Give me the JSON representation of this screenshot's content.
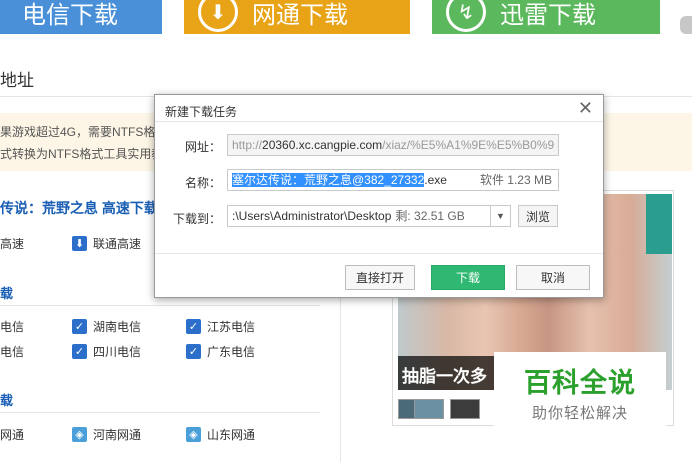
{
  "top_buttons": {
    "telecom": "电信下载",
    "netcom": "网通下载",
    "thunder": "迅雷下载"
  },
  "page": {
    "address_title": "地址",
    "notice_line1": "果游戏超过4G，需要NTFS格式",
    "notice_line2": "式转换为NTFS格式工具实用教",
    "game_title": "传说：荒野之息 高速下载",
    "first_row": [
      {
        "label": "高速"
      },
      {
        "label": "联通高速"
      }
    ],
    "telecom_section": "载",
    "telecom_links": [
      [
        "电信",
        "湖南电信",
        "江苏电信"
      ],
      [
        "电信",
        "四川电信",
        "广东电信"
      ]
    ],
    "netcom_section": "载",
    "netcom_links": [
      "网通",
      "河南网通",
      "山东网通"
    ],
    "photo_caption": "抽脂一次多",
    "watermark_line1": "百科全说",
    "watermark_line2": "助你轻松解决"
  },
  "dialog": {
    "title": "新建下载任务",
    "url_label": "网址：",
    "url_prefix": "http://",
    "url_host": "20360.xc.cangpie.com",
    "url_rest": "/xiaz/%E5%A1%9E%E5%B0%9",
    "name_label": "名称：",
    "name_selected": "塞尔达传说：荒野之息@382_27332",
    "name_ext": ".exe",
    "size_text": "软件 1.23 MB",
    "save_label": "下载到：",
    "save_path": ":\\Users\\Administrator\\Desktop",
    "free_space": "剩: 32.51 GB",
    "browse_label": "浏览",
    "open_label": "直接打开",
    "download_label": "下载",
    "cancel_label": "取消"
  },
  "colors": {
    "telecom_button": "#4a90d9",
    "netcom_button": "#e8a317",
    "thunder_button": "#5cb85c",
    "download_button": "#2eb872",
    "selection": "#3390ff"
  }
}
